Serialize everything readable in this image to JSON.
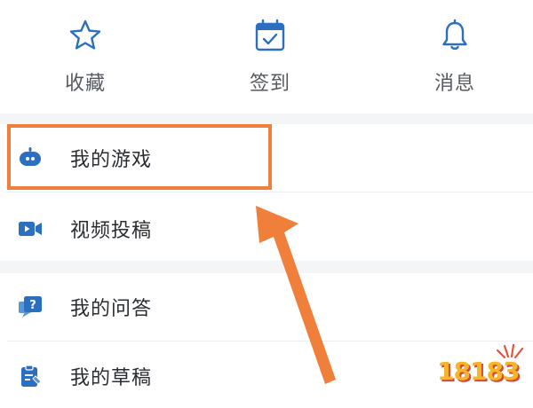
{
  "quick_actions": [
    {
      "label": "收藏",
      "icon": "star-icon"
    },
    {
      "label": "签到",
      "icon": "calendar-check-icon"
    },
    {
      "label": "消息",
      "icon": "bell-icon"
    }
  ],
  "menu": {
    "items": [
      {
        "label": "我的游戏",
        "icon": "gamepad-icon"
      },
      {
        "label": "视频投稿",
        "icon": "video-camera-icon"
      },
      {
        "label": "我的问答",
        "icon": "question-chat-icon"
      },
      {
        "label": "我的草稿",
        "icon": "clipboard-edit-icon"
      }
    ]
  },
  "colors": {
    "icon_blue": "#2c6fc0",
    "highlight": "#f07f3c",
    "separator_band": "#f4f5f7"
  },
  "watermark": {
    "text": "18183"
  }
}
